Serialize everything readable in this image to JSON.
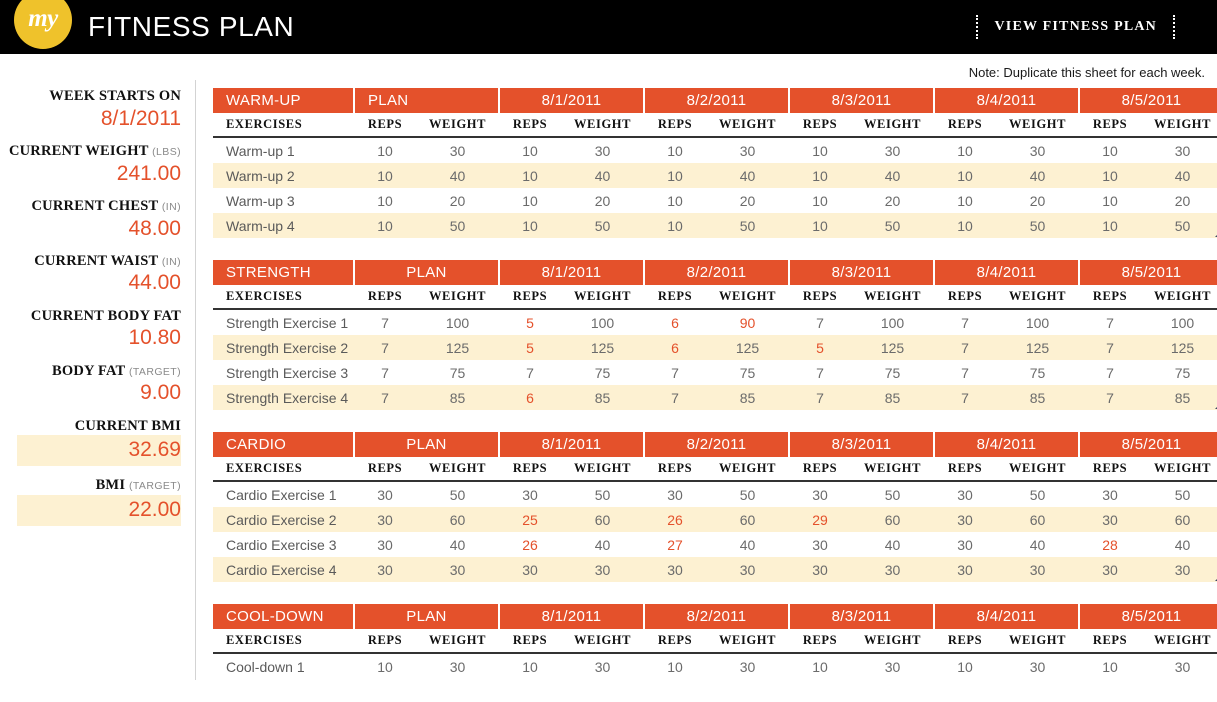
{
  "header": {
    "logo_text": "my",
    "title": "FITNESS PLAN",
    "view_link": "VIEW  FITNESS  PLAN",
    "note": "Note: Duplicate this sheet for each week.",
    "bar_color": "#000000",
    "logo_color": "#efc22b"
  },
  "colors": {
    "accent_orange": "#e4512b",
    "row_cream": "#fdf1d2",
    "text_gray": "#6b6b6b"
  },
  "sidebar": {
    "stats": [
      {
        "label": "WEEK STARTS ON",
        "unit": "",
        "value": "8/1/2011",
        "highlight": false
      },
      {
        "label": "CURRENT WEIGHT",
        "unit": "(LBS)",
        "value": "241.00",
        "highlight": false
      },
      {
        "label": "CURRENT CHEST",
        "unit": "(IN)",
        "value": "48.00",
        "highlight": false
      },
      {
        "label": "CURRENT WAIST",
        "unit": "(IN)",
        "value": "44.00",
        "highlight": false
      },
      {
        "label": "CURRENT BODY FAT",
        "unit": "",
        "value": "10.80",
        "highlight": false
      },
      {
        "label": "BODY FAT",
        "unit": "(TARGET)",
        "value": "9.00",
        "highlight": false
      },
      {
        "label": "CURRENT BMI",
        "unit": "",
        "value": "32.69",
        "highlight": true
      },
      {
        "label": "BMI",
        "unit": "(TARGET)",
        "value": "22.00",
        "highlight": true
      }
    ]
  },
  "tables": {
    "column_groups": [
      "PLAN",
      "8/1/2011",
      "8/2/2011",
      "8/3/2011",
      "8/4/2011",
      "8/5/2011"
    ],
    "sub_headers": {
      "exercises": "EXERCISES",
      "reps": "REPS",
      "weight": "WEIGHT"
    },
    "sections": [
      {
        "title": "WARM-UP",
        "plan_align": "left",
        "rows": [
          {
            "name": "Warm-up 1",
            "cells": [
              {
                "reps": "10",
                "weight": "30",
                "reps_below": false,
                "weight_below": false
              },
              {
                "reps": "10",
                "weight": "30",
                "reps_below": false,
                "weight_below": false
              },
              {
                "reps": "10",
                "weight": "30",
                "reps_below": false,
                "weight_below": false
              },
              {
                "reps": "10",
                "weight": "30",
                "reps_below": false,
                "weight_below": false
              },
              {
                "reps": "10",
                "weight": "30",
                "reps_below": false,
                "weight_below": false
              },
              {
                "reps": "10",
                "weight": "30",
                "reps_below": false,
                "weight_below": false
              }
            ]
          },
          {
            "name": "Warm-up 2",
            "cells": [
              {
                "reps": "10",
                "weight": "40",
                "reps_below": false,
                "weight_below": false
              },
              {
                "reps": "10",
                "weight": "40",
                "reps_below": false,
                "weight_below": false
              },
              {
                "reps": "10",
                "weight": "40",
                "reps_below": false,
                "weight_below": false
              },
              {
                "reps": "10",
                "weight": "40",
                "reps_below": false,
                "weight_below": false
              },
              {
                "reps": "10",
                "weight": "40",
                "reps_below": false,
                "weight_below": false
              },
              {
                "reps": "10",
                "weight": "40",
                "reps_below": false,
                "weight_below": false
              }
            ]
          },
          {
            "name": "Warm-up 3",
            "cells": [
              {
                "reps": "10",
                "weight": "20",
                "reps_below": false,
                "weight_below": false
              },
              {
                "reps": "10",
                "weight": "20",
                "reps_below": false,
                "weight_below": false
              },
              {
                "reps": "10",
                "weight": "20",
                "reps_below": false,
                "weight_below": false
              },
              {
                "reps": "10",
                "weight": "20",
                "reps_below": false,
                "weight_below": false
              },
              {
                "reps": "10",
                "weight": "20",
                "reps_below": false,
                "weight_below": false
              },
              {
                "reps": "10",
                "weight": "20",
                "reps_below": false,
                "weight_below": false
              }
            ]
          },
          {
            "name": "Warm-up 4",
            "cells": [
              {
                "reps": "10",
                "weight": "50",
                "reps_below": false,
                "weight_below": false
              },
              {
                "reps": "10",
                "weight": "50",
                "reps_below": false,
                "weight_below": false
              },
              {
                "reps": "10",
                "weight": "50",
                "reps_below": false,
                "weight_below": false
              },
              {
                "reps": "10",
                "weight": "50",
                "reps_below": false,
                "weight_below": false
              },
              {
                "reps": "10",
                "weight": "50",
                "reps_below": false,
                "weight_below": false
              },
              {
                "reps": "10",
                "weight": "50",
                "reps_below": false,
                "weight_below": false
              }
            ]
          }
        ]
      },
      {
        "title": "STRENGTH",
        "plan_align": "center",
        "rows": [
          {
            "name": "Strength Exercise 1",
            "cells": [
              {
                "reps": "7",
                "weight": "100",
                "reps_below": false,
                "weight_below": false
              },
              {
                "reps": "5",
                "weight": "100",
                "reps_below": true,
                "weight_below": false
              },
              {
                "reps": "6",
                "weight": "90",
                "reps_below": true,
                "weight_below": true
              },
              {
                "reps": "7",
                "weight": "100",
                "reps_below": false,
                "weight_below": false
              },
              {
                "reps": "7",
                "weight": "100",
                "reps_below": false,
                "weight_below": false
              },
              {
                "reps": "7",
                "weight": "100",
                "reps_below": false,
                "weight_below": false
              }
            ]
          },
          {
            "name": "Strength Exercise 2",
            "cells": [
              {
                "reps": "7",
                "weight": "125",
                "reps_below": false,
                "weight_below": false
              },
              {
                "reps": "5",
                "weight": "125",
                "reps_below": true,
                "weight_below": false
              },
              {
                "reps": "6",
                "weight": "125",
                "reps_below": true,
                "weight_below": false
              },
              {
                "reps": "5",
                "weight": "125",
                "reps_below": true,
                "weight_below": false
              },
              {
                "reps": "7",
                "weight": "125",
                "reps_below": false,
                "weight_below": false
              },
              {
                "reps": "7",
                "weight": "125",
                "reps_below": false,
                "weight_below": false
              }
            ]
          },
          {
            "name": "Strength Exercise 3",
            "cells": [
              {
                "reps": "7",
                "weight": "75",
                "reps_below": false,
                "weight_below": false
              },
              {
                "reps": "7",
                "weight": "75",
                "reps_below": false,
                "weight_below": false
              },
              {
                "reps": "7",
                "weight": "75",
                "reps_below": false,
                "weight_below": false
              },
              {
                "reps": "7",
                "weight": "75",
                "reps_below": false,
                "weight_below": false
              },
              {
                "reps": "7",
                "weight": "75",
                "reps_below": false,
                "weight_below": false
              },
              {
                "reps": "7",
                "weight": "75",
                "reps_below": false,
                "weight_below": false
              }
            ]
          },
          {
            "name": "Strength Exercise 4",
            "cells": [
              {
                "reps": "7",
                "weight": "85",
                "reps_below": false,
                "weight_below": false
              },
              {
                "reps": "6",
                "weight": "85",
                "reps_below": true,
                "weight_below": false
              },
              {
                "reps": "7",
                "weight": "85",
                "reps_below": false,
                "weight_below": false
              },
              {
                "reps": "7",
                "weight": "85",
                "reps_below": false,
                "weight_below": false
              },
              {
                "reps": "7",
                "weight": "85",
                "reps_below": false,
                "weight_below": false
              },
              {
                "reps": "7",
                "weight": "85",
                "reps_below": false,
                "weight_below": false
              }
            ]
          }
        ]
      },
      {
        "title": "CARDIO",
        "plan_align": "center",
        "rows": [
          {
            "name": "Cardio Exercise 1",
            "cells": [
              {
                "reps": "30",
                "weight": "50",
                "reps_below": false,
                "weight_below": false
              },
              {
                "reps": "30",
                "weight": "50",
                "reps_below": false,
                "weight_below": false
              },
              {
                "reps": "30",
                "weight": "50",
                "reps_below": false,
                "weight_below": false
              },
              {
                "reps": "30",
                "weight": "50",
                "reps_below": false,
                "weight_below": false
              },
              {
                "reps": "30",
                "weight": "50",
                "reps_below": false,
                "weight_below": false
              },
              {
                "reps": "30",
                "weight": "50",
                "reps_below": false,
                "weight_below": false
              }
            ]
          },
          {
            "name": "Cardio Exercise 2",
            "cells": [
              {
                "reps": "30",
                "weight": "60",
                "reps_below": false,
                "weight_below": false
              },
              {
                "reps": "25",
                "weight": "60",
                "reps_below": true,
                "weight_below": false
              },
              {
                "reps": "26",
                "weight": "60",
                "reps_below": true,
                "weight_below": false
              },
              {
                "reps": "29",
                "weight": "60",
                "reps_below": true,
                "weight_below": false
              },
              {
                "reps": "30",
                "weight": "60",
                "reps_below": false,
                "weight_below": false
              },
              {
                "reps": "30",
                "weight": "60",
                "reps_below": false,
                "weight_below": false
              }
            ]
          },
          {
            "name": "Cardio Exercise 3",
            "cells": [
              {
                "reps": "30",
                "weight": "40",
                "reps_below": false,
                "weight_below": false
              },
              {
                "reps": "26",
                "weight": "40",
                "reps_below": true,
                "weight_below": false
              },
              {
                "reps": "27",
                "weight": "40",
                "reps_below": true,
                "weight_below": false
              },
              {
                "reps": "30",
                "weight": "40",
                "reps_below": false,
                "weight_below": false
              },
              {
                "reps": "30",
                "weight": "40",
                "reps_below": false,
                "weight_below": false
              },
              {
                "reps": "28",
                "weight": "40",
                "reps_below": true,
                "weight_below": false
              }
            ]
          },
          {
            "name": "Cardio Exercise 4",
            "cells": [
              {
                "reps": "30",
                "weight": "30",
                "reps_below": false,
                "weight_below": false
              },
              {
                "reps": "30",
                "weight": "30",
                "reps_below": false,
                "weight_below": false
              },
              {
                "reps": "30",
                "weight": "30",
                "reps_below": false,
                "weight_below": false
              },
              {
                "reps": "30",
                "weight": "30",
                "reps_below": false,
                "weight_below": false
              },
              {
                "reps": "30",
                "weight": "30",
                "reps_below": false,
                "weight_below": false
              },
              {
                "reps": "30",
                "weight": "30",
                "reps_below": false,
                "weight_below": false
              }
            ]
          }
        ]
      },
      {
        "title": "COOL-DOWN",
        "plan_align": "center",
        "rows": [
          {
            "name": "Cool-down 1",
            "cells": [
              {
                "reps": "10",
                "weight": "30",
                "reps_below": false,
                "weight_below": false
              },
              {
                "reps": "10",
                "weight": "30",
                "reps_below": false,
                "weight_below": false
              },
              {
                "reps": "10",
                "weight": "30",
                "reps_below": false,
                "weight_below": false
              },
              {
                "reps": "10",
                "weight": "30",
                "reps_below": false,
                "weight_below": false
              },
              {
                "reps": "10",
                "weight": "30",
                "reps_below": false,
                "weight_below": false
              },
              {
                "reps": "10",
                "weight": "30",
                "reps_below": false,
                "weight_below": false
              }
            ]
          }
        ]
      }
    ]
  }
}
